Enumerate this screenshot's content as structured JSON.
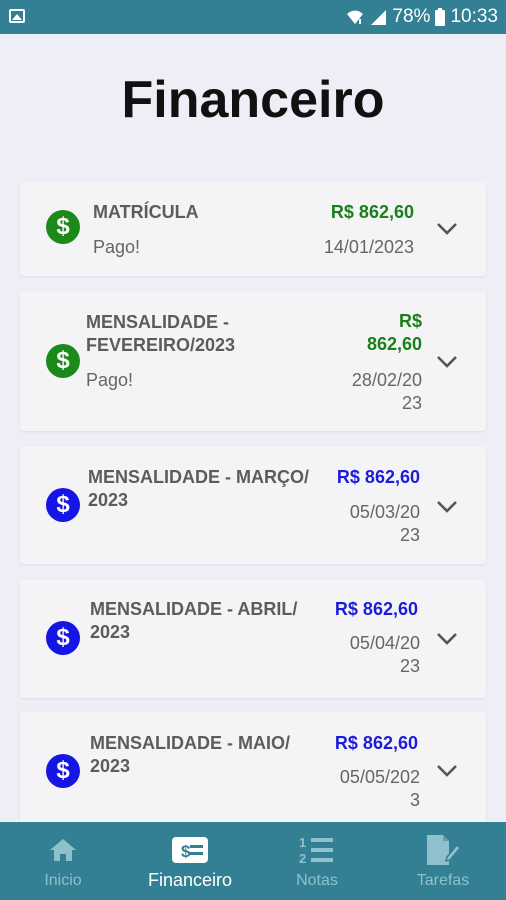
{
  "status_bar": {
    "battery": "78%",
    "time": "10:33"
  },
  "page": {
    "title": "Financeiro"
  },
  "payments": [
    {
      "description": [
        "MATRÍCULA"
      ],
      "amount": [
        "R$ 862,60"
      ],
      "status": "Pago!",
      "date": [
        "14/01/2023"
      ],
      "paid": true
    },
    {
      "description": [
        "MENSALIDADE -",
        "FEVEREIRO/2023"
      ],
      "amount": [
        "R$",
        "862,60"
      ],
      "status": "Pago!",
      "date": [
        "28/02/20",
        "23"
      ],
      "paid": true
    },
    {
      "description": [
        "MENSALIDADE - MARÇO/",
        "2023"
      ],
      "amount": [
        "R$ 862,60"
      ],
      "status": "",
      "date": [
        "05/03/20",
        "23"
      ],
      "paid": false
    },
    {
      "description": [
        "MENSALIDADE - ABRIL/",
        "2023"
      ],
      "amount": [
        "R$ 862,60"
      ],
      "status": "",
      "date": [
        "05/04/20",
        "23"
      ],
      "paid": false
    },
    {
      "description": [
        "MENSALIDADE - MAIO/",
        "2023"
      ],
      "amount": [
        "R$ 862,60"
      ],
      "status": "",
      "date": [
        "05/05/202",
        "3"
      ],
      "paid": false
    }
  ],
  "coin_symbol": "$",
  "colors": {
    "paid": "#1b8a1b",
    "pending": "#1515e6",
    "bar": "#337f93"
  },
  "nav": [
    {
      "label": "Inicio",
      "icon": "home-icon"
    },
    {
      "label": "Financeiro",
      "icon": "money-icon"
    },
    {
      "label": "Notas",
      "icon": "numbered-list-icon"
    },
    {
      "label": "Tarefas",
      "icon": "document-edit-icon"
    }
  ]
}
